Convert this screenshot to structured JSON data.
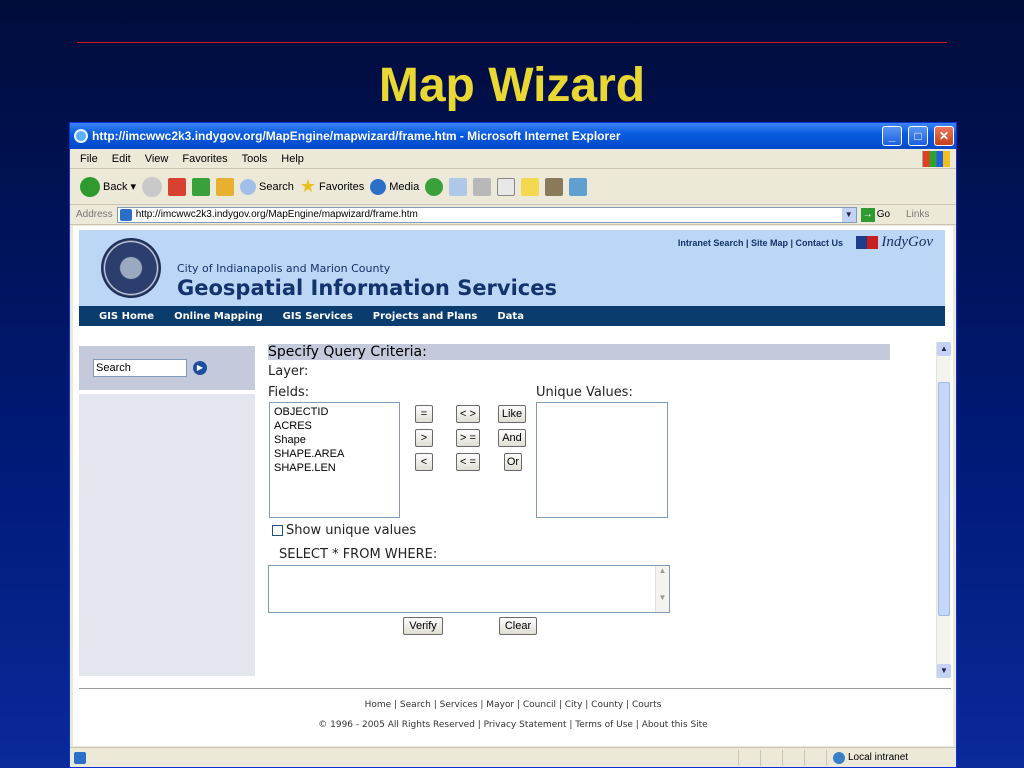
{
  "slide": {
    "title": "Map Wizard"
  },
  "window": {
    "title": "http://imcwwc2k3.indygov.org/MapEngine/mapwizard/frame.htm - Microsoft Internet Explorer"
  },
  "menu": [
    "File",
    "Edit",
    "View",
    "Favorites",
    "Tools",
    "Help"
  ],
  "toolbar": {
    "back": "Back",
    "search": "Search",
    "favorites": "Favorites",
    "media": "Media"
  },
  "address": {
    "label": "Address",
    "url": "http://imcwwc2k3.indygov.org/MapEngine/mapwizard/frame.htm",
    "go": "Go",
    "links": "Links"
  },
  "site": {
    "top_links": "Intranet Search | Site Map | Contact Us",
    "brand": "IndyGov",
    "org": "City of Indianapolis and Marion County",
    "title": "Geospatial Information Services",
    "nav": [
      "GIS Home",
      "Online Mapping",
      "GIS Services",
      "Projects and Plans",
      "Data"
    ],
    "search_value": "Search"
  },
  "query": {
    "heading": "Specify Query Criteria:",
    "layer_label": "Layer:",
    "fields_label": "Fields:",
    "fields": [
      "OBJECTID",
      "ACRES",
      "Shape",
      "SHAPE.AREA",
      "SHAPE.LEN"
    ],
    "unique_label": "Unique Values:",
    "operators": [
      "=",
      "< >",
      "Like",
      ">",
      "> =",
      "And",
      "<",
      "< =",
      "Or"
    ],
    "show_unique": "Show unique values",
    "sql_label": "SELECT * FROM WHERE:",
    "verify": "Verify",
    "clear": "Clear"
  },
  "footer": {
    "links": "Home | Search | Services | Mayor | Council | City | County | Courts",
    "copyright": "© 1996 - 2005 All Rights Reserved | Privacy Statement | Terms of Use | About this Site"
  },
  "status": {
    "zone": "Local intranet"
  }
}
